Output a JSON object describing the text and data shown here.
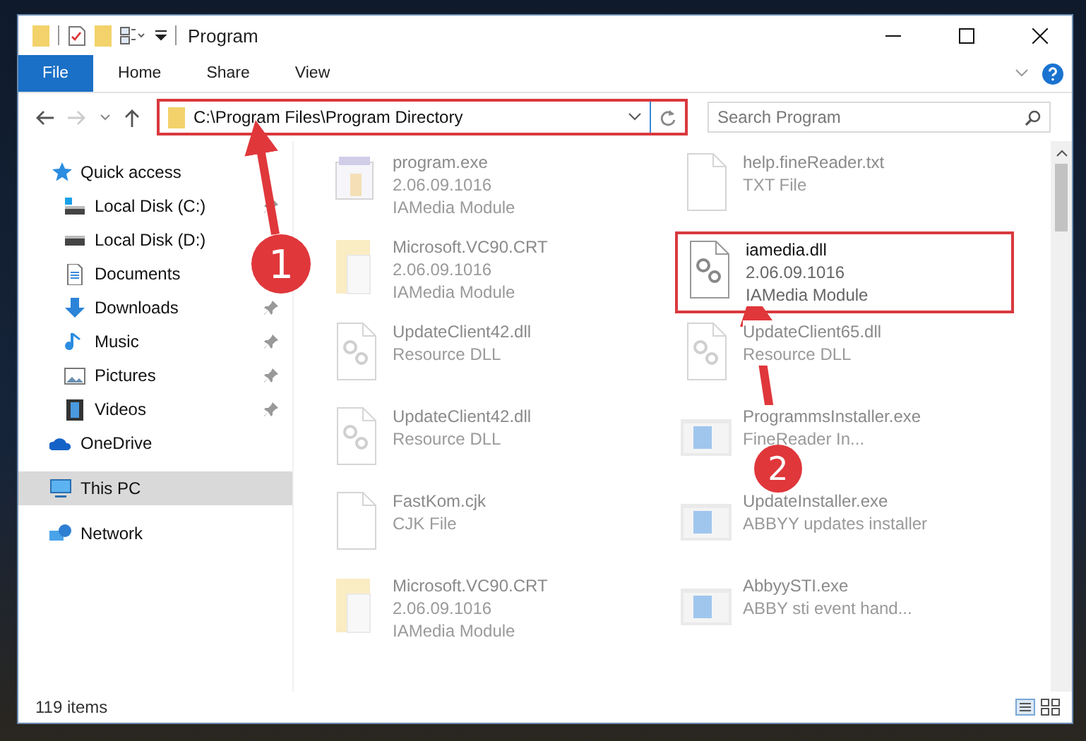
{
  "window": {
    "title": "Program"
  },
  "ribbon_tabs": [
    {
      "label": "File",
      "selected": true
    },
    {
      "label": "Home",
      "selected": false
    },
    {
      "label": "Share",
      "selected": false
    },
    {
      "label": "View",
      "selected": false
    }
  ],
  "address": {
    "path": "C:\\Program Files\\Program Directory",
    "highlighted": true
  },
  "search": {
    "placeholder": "Search Program"
  },
  "sidebar": {
    "items": [
      {
        "label": "Quick access",
        "kind": "star",
        "selected": false,
        "children": [
          {
            "label": "Local Disk (C:)",
            "kind": "disk-c",
            "pinned": true,
            "selected": false
          },
          {
            "label": "Local Disk (D:)",
            "kind": "disk",
            "pinned": false,
            "selected": false
          },
          {
            "label": "Documents",
            "kind": "documents",
            "pinned": false,
            "selected": false
          },
          {
            "label": "Downloads",
            "kind": "downloads",
            "pinned": true,
            "selected": false
          },
          {
            "label": "Music",
            "kind": "music",
            "pinned": true,
            "selected": false
          },
          {
            "label": "Pictures",
            "kind": "pictures",
            "pinned": true,
            "selected": false
          },
          {
            "label": "Videos",
            "kind": "videos",
            "pinned": true,
            "selected": false
          }
        ]
      },
      {
        "label": "OneDrive",
        "kind": "cloud",
        "selected": false
      },
      {
        "label": "This PC",
        "kind": "pc",
        "selected": true
      },
      {
        "label": "Network",
        "kind": "network",
        "selected": false
      }
    ]
  },
  "files": [
    {
      "name": "program.exe",
      "details": [
        "2.06.09.1016",
        "IAMedia Module"
      ],
      "kind": "exe",
      "dimmed": true,
      "highlighted": false
    },
    {
      "name": "help.fineReader.txt",
      "details": [
        "TXT File"
      ],
      "kind": "txt",
      "dimmed": true,
      "highlighted": false
    },
    {
      "name": "Microsoft.VC90.CRT",
      "details": [
        "2.06.09.1016",
        "IAMedia Module"
      ],
      "kind": "folder",
      "dimmed": true,
      "highlighted": false
    },
    {
      "name": "iamedia.dll",
      "details": [
        "2.06.09.1016",
        "IAMedia Module"
      ],
      "kind": "dll",
      "dimmed": false,
      "highlighted": true
    },
    {
      "name": "UpdateClient42.dll",
      "details": [
        "Resource DLL"
      ],
      "kind": "dll",
      "dimmed": true,
      "highlighted": false
    },
    {
      "name": "UpdateClient65.dll",
      "details": [
        "Resource DLL"
      ],
      "kind": "dll",
      "dimmed": true,
      "highlighted": false
    },
    {
      "name": "UpdateClient42.dll",
      "details": [
        "Resource DLL"
      ],
      "kind": "dll",
      "dimmed": true,
      "highlighted": false
    },
    {
      "name": "ProgrammsInstaller.exe",
      "details": [
        "FineReader In..."
      ],
      "kind": "installer",
      "dimmed": true,
      "highlighted": false
    },
    {
      "name": "FastKom.cjk",
      "details": [
        "CJK File"
      ],
      "kind": "txt",
      "dimmed": true,
      "highlighted": false
    },
    {
      "name": "UpdateInstaller.exe",
      "details": [
        "ABBYY updates installer"
      ],
      "kind": "installer",
      "dimmed": true,
      "highlighted": false
    },
    {
      "name": "Microsoft.VC90.CRT",
      "details": [
        "2.06.09.1016",
        "IAMedia Module"
      ],
      "kind": "folder",
      "dimmed": true,
      "highlighted": false
    },
    {
      "name": "AbbyySTI.exe",
      "details": [
        "ABBY sti event hand..."
      ],
      "kind": "installer",
      "dimmed": true,
      "highlighted": false
    }
  ],
  "status_bar": {
    "count": "119 items"
  },
  "callouts": [
    {
      "number": "1"
    },
    {
      "number": "2"
    }
  ]
}
